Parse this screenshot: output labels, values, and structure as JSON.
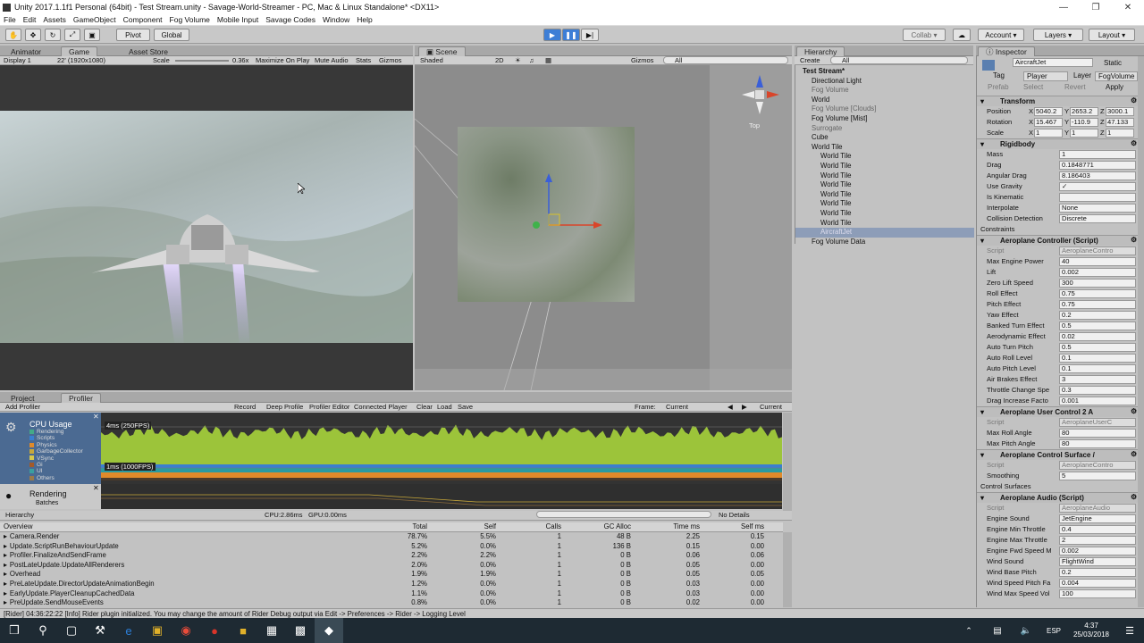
{
  "window": {
    "title": "Unity 2017.1.1f1 Personal (64bit) - Test Stream.unity - Savage-World-Streamer - PC, Mac & Linux Standalone* <DX11>"
  },
  "menu": [
    "File",
    "Edit",
    "Assets",
    "GameObject",
    "Component",
    "Fog Volume",
    "Mobile Input",
    "Savage Codes",
    "Window",
    "Help"
  ],
  "toolbar": {
    "pivot": "Pivot",
    "global": "Global",
    "collab": "Collab",
    "account": "Account",
    "layers": "Layers",
    "layout": "Layout"
  },
  "game": {
    "tabs": [
      "Animator",
      "Game",
      "Asset Store"
    ],
    "display": "Display 1",
    "resolution": "22' (1920x1080)",
    "scale_label": "Scale",
    "scale_value": "0.36x",
    "maximize": "Maximize On Play",
    "mute": "Mute Audio",
    "stats": "Stats",
    "gizmos": "Gizmos"
  },
  "scene": {
    "tab": "Scene",
    "shading": "Shaded",
    "mode2d": "2D",
    "gizmos": "Gizmos",
    "search_placeholder": "All",
    "view": "Top"
  },
  "hierarchy": {
    "tab": "Hierarchy",
    "create": "Create",
    "search_placeholder": "All",
    "items": [
      {
        "label": "Test Stream*",
        "indent": 0,
        "style": "root"
      },
      {
        "label": "Directional Light",
        "indent": 1,
        "style": "normal"
      },
      {
        "label": "Fog Volume",
        "indent": 1,
        "style": "gray"
      },
      {
        "label": "World",
        "indent": 1,
        "style": "normal"
      },
      {
        "label": "Fog Volume [Clouds]",
        "indent": 1,
        "style": "gray"
      },
      {
        "label": "Fog Volume [Mist]",
        "indent": 1,
        "style": "normal"
      },
      {
        "label": "Surrogate",
        "indent": 1,
        "style": "gray"
      },
      {
        "label": "Cube",
        "indent": 1,
        "style": "normal"
      },
      {
        "label": "World Tile",
        "indent": 1,
        "style": "normal"
      },
      {
        "label": "World Tile",
        "indent": 2,
        "style": "normal"
      },
      {
        "label": "World Tile",
        "indent": 2,
        "style": "normal"
      },
      {
        "label": "World Tile",
        "indent": 2,
        "style": "normal"
      },
      {
        "label": "World Tile",
        "indent": 2,
        "style": "normal"
      },
      {
        "label": "World Tile",
        "indent": 2,
        "style": "normal"
      },
      {
        "label": "World Tile",
        "indent": 2,
        "style": "normal"
      },
      {
        "label": "World Tile",
        "indent": 2,
        "style": "normal"
      },
      {
        "label": "World Tile",
        "indent": 2,
        "style": "normal"
      },
      {
        "label": "AircraftJet",
        "indent": 2,
        "style": "selected"
      },
      {
        "label": "Fog Volume Data",
        "indent": 1,
        "style": "normal"
      }
    ]
  },
  "inspector": {
    "tab": "Inspector",
    "object_name": "AircraftJet",
    "static": "Static",
    "tag_label": "Tag",
    "tag": "Player",
    "layer_label": "Layer",
    "layer": "FogVolume",
    "prefab": "Prefab",
    "select": "Select",
    "revert": "Revert",
    "apply": "Apply",
    "transform": {
      "title": "Transform",
      "position": "Position",
      "rotation": "Rotation",
      "scale": "Scale",
      "pos": [
        "5040.2",
        "2653.2",
        "3000.1"
      ],
      "rot": [
        "15.467",
        "-110.9",
        "47.133"
      ],
      "scl": [
        "1",
        "1",
        "1"
      ]
    },
    "rigidbody": {
      "title": "Rigidbody",
      "fields": [
        [
          "Mass",
          "1"
        ],
        [
          "Drag",
          "0.1848771"
        ],
        [
          "Angular Drag",
          "8.186403"
        ],
        [
          "Use Gravity",
          "✓"
        ],
        [
          "Is Kinematic",
          ""
        ],
        [
          "Interpolate",
          "None"
        ],
        [
          "Collision Detection",
          "Discrete"
        ]
      ],
      "constraints": "Constraints"
    },
    "aeroplane_controller": {
      "title": "Aeroplane Controller (Script)",
      "script": "AeroplaneContro",
      "fields": [
        [
          "Max Engine Power",
          "40"
        ],
        [
          "Lift",
          "0.002"
        ],
        [
          "Zero Lift Speed",
          "300"
        ],
        [
          "Roll Effect",
          "0.75"
        ],
        [
          "Pitch Effect",
          "0.75"
        ],
        [
          "Yaw Effect",
          "0.2"
        ],
        [
          "Banked Turn Effect",
          "0.5"
        ],
        [
          "Aerodynamic Effect",
          "0.02"
        ],
        [
          "Auto Turn Pitch",
          "0.5"
        ],
        [
          "Auto Roll Level",
          "0.1"
        ],
        [
          "Auto Pitch Level",
          "0.1"
        ],
        [
          "Air Brakes Effect",
          "3"
        ],
        [
          "Throttle Change Spe",
          "0.3"
        ],
        [
          "Drag Increase Facto",
          "0.001"
        ]
      ]
    },
    "user_control": {
      "title": "Aeroplane User Control 2 A",
      "script": "AeroplaneUserC",
      "fields": [
        [
          "Max Roll Angle",
          "80"
        ],
        [
          "Max Pitch Angle",
          "80"
        ]
      ]
    },
    "control_surface": {
      "title": "Aeroplane Control Surface /",
      "script": "AeroplaneContro",
      "fields": [
        [
          "Smoothing",
          "5"
        ]
      ],
      "surfaces": "Control Surfaces"
    },
    "audio": {
      "title": "Aeroplane Audio (Script)",
      "script": "AeroplaneAudio",
      "fields": [
        [
          "Engine Sound",
          "JetEngine"
        ],
        [
          "Engine Min Throttle",
          "0.4"
        ],
        [
          "Engine Max Throttle",
          "2"
        ],
        [
          "Engine Fwd Speed M",
          "0.002"
        ],
        [
          "Wind Sound",
          "FlightWind"
        ],
        [
          "Wind Base Pitch",
          "0.2"
        ],
        [
          "Wind Speed Pitch Fa",
          "0.004"
        ],
        [
          "Wind Max Speed Vol",
          "100"
        ]
      ]
    }
  },
  "profiler": {
    "tabs": [
      "Project",
      "Profiler"
    ],
    "add_profiler": "Add Profiler",
    "record": "Record",
    "deep": "Deep Profile",
    "editor": "Profiler Editor",
    "connected": "Connected Player",
    "clear": "Clear",
    "load": "Load",
    "save": "Save",
    "frame_label": "Frame:",
    "frame_value": "Current",
    "current_btn": "Current",
    "cpu_title": "CPU Usage",
    "cpu_legend": [
      [
        "Rendering",
        "#4a8"
      ],
      [
        "Scripts",
        "#3a7fd0"
      ],
      [
        "Physics",
        "#e08a2a"
      ],
      [
        "GarbageCollector",
        "#c8a83a"
      ],
      [
        "VSync",
        "#d9c84a"
      ],
      [
        "Gi",
        "#a35a2a"
      ],
      [
        "UI",
        "#3a9f9f"
      ],
      [
        "Others",
        "#9a7a4a"
      ]
    ],
    "rendering_title": "Rendering",
    "rendering_items": [
      "Batches",
      "SetPass Calls"
    ],
    "label_4ms": "4ms (250FPS)",
    "label_1ms": "1ms (1000FPS)",
    "hierarchy_mode": "Hierarchy",
    "cpu_stat": "CPU:2.86ms",
    "gpu_stat": "GPU:0.00ms",
    "no_details": "No Details",
    "columns": [
      "Overview",
      "Total",
      "Self",
      "Calls",
      "GC Alloc",
      "Time ms",
      "Self ms"
    ],
    "rows": [
      [
        "Camera.Render",
        "78.7%",
        "5.5%",
        "1",
        "48 B",
        "2.25",
        "0.15"
      ],
      [
        "Update.ScriptRunBehaviourUpdate",
        "5.2%",
        "0.0%",
        "1",
        "136 B",
        "0.15",
        "0.00"
      ],
      [
        "Profiler.FinalizeAndSendFrame",
        "2.2%",
        "2.2%",
        "1",
        "0 B",
        "0.06",
        "0.06"
      ],
      [
        "PostLateUpdate.UpdateAllRenderers",
        "2.0%",
        "0.0%",
        "1",
        "0 B",
        "0.05",
        "0.00"
      ],
      [
        "Overhead",
        "1.9%",
        "1.9%",
        "1",
        "0 B",
        "0.05",
        "0.05"
      ],
      [
        "PreLateUpdate.DirectorUpdateAnimationBegin",
        "1.2%",
        "0.0%",
        "1",
        "0 B",
        "0.03",
        "0.00"
      ],
      [
        "EarlyUpdate.PlayerCleanupCachedData",
        "1.1%",
        "0.0%",
        "1",
        "0 B",
        "0.03",
        "0.00"
      ],
      [
        "PreUpdate.SendMouseEvents",
        "0.8%",
        "0.0%",
        "1",
        "0 B",
        "0.02",
        "0.00"
      ]
    ]
  },
  "status": "[Rider] 04:36:22:22 [Info] Rider plugin initialized. You may change the amount of Rider Debug output via Edit -> Preferences -> Rider -> Logging Level",
  "taskbar": {
    "lang": "ESP",
    "time": "4:37",
    "date": "25/03/2018"
  },
  "colors": {
    "graph_green": "#9cc43a",
    "selection": "#8d9db8"
  }
}
